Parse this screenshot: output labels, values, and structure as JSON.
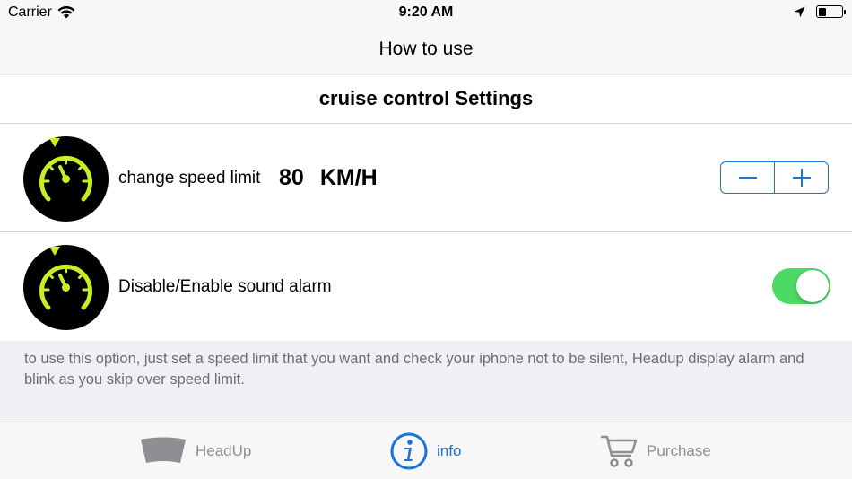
{
  "status_bar": {
    "carrier": "Carrier",
    "time": "9:20 AM"
  },
  "nav": {
    "title": "How to use"
  },
  "section": {
    "title": "cruise control Settings"
  },
  "rows": [
    {
      "label": "change speed limit",
      "speed_value": "80",
      "speed_unit": "KM/H"
    },
    {
      "label": "Disable/Enable sound alarm",
      "toggle_on": true
    }
  ],
  "note": "to use this option, just set a speed limit that you want and check your iphone not to be silent, Headup display alarm and blink as you skip over speed limit.",
  "tabs": [
    {
      "label": "HeadUp",
      "icon": "headup-icon",
      "active": false
    },
    {
      "label": "info",
      "icon": "info-icon",
      "active": true
    },
    {
      "label": "Purchase",
      "icon": "cart-icon",
      "active": false
    }
  ],
  "colors": {
    "accent": "#1a73d9",
    "toggle_on": "#4cd964",
    "gauge": "#c6f021",
    "tab_inactive": "#8e8e93"
  }
}
